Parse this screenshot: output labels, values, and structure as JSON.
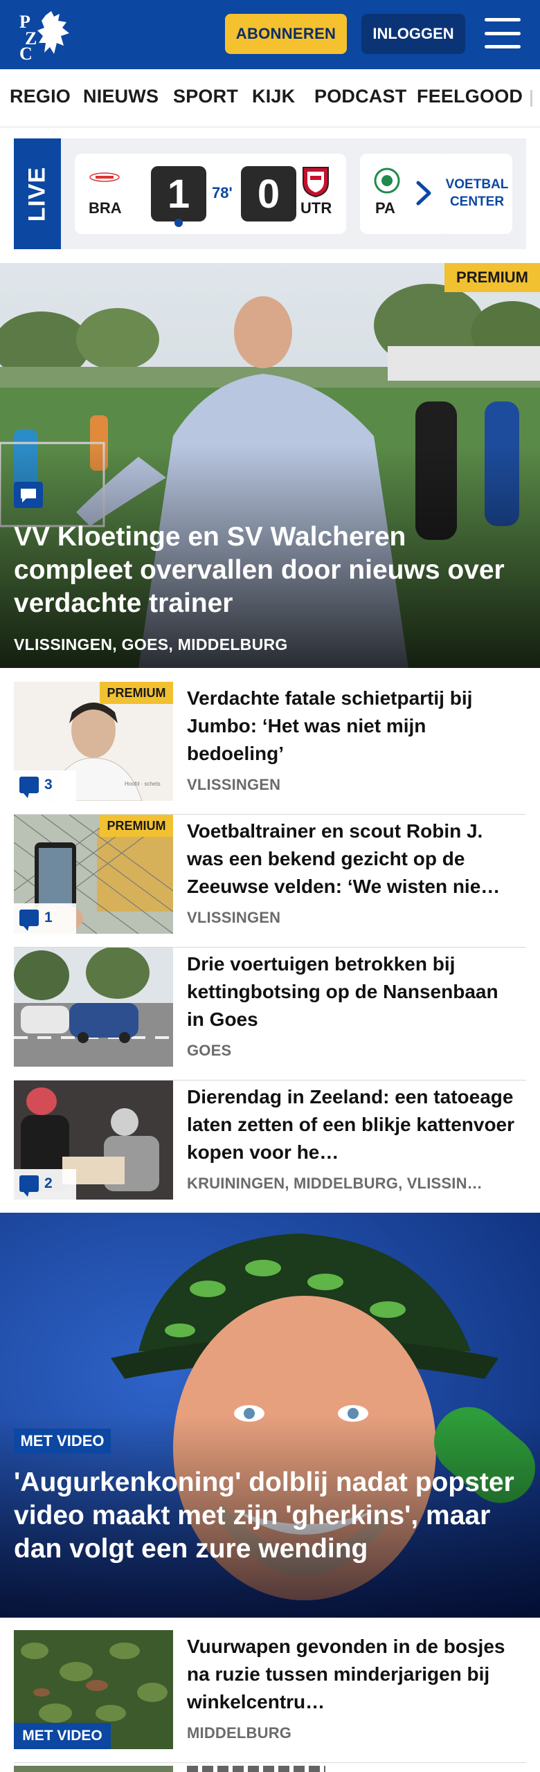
{
  "header": {
    "logo_text": "PZC",
    "subscribe_label": "ABONNEREN",
    "login_label": "INLOGGEN",
    "brand_color": "#0c47a2",
    "accent_color": "#f5c12e"
  },
  "nav": {
    "items": [
      "REGIO",
      "NIEUWS",
      "SPORT",
      "KIJK",
      "PODCAST",
      "FEELGOOD"
    ]
  },
  "live": {
    "label": "LIVE",
    "match": {
      "home": "BRA",
      "away": "UTR",
      "home_score": "1",
      "away_score": "0",
      "minute": "78'"
    },
    "next_match_team": "PA",
    "voetbal_center_label": "VOETBAL CENTER"
  },
  "hero": {
    "badge": "PREMIUM",
    "title": "VV Kloetinge en SV Walcheren compleet overvallen door nieuws over verdachte trainer",
    "location": "VLISSINGEN, GOES, MIDDELBURG"
  },
  "articles": [
    {
      "title": "Verdachte fatale schietpartij bij Jumbo: ‘Het was niet mijn bedoeling’",
      "location": "VLISSINGEN",
      "badge": "PREMIUM",
      "comments": "3"
    },
    {
      "title": "Voetbaltrainer en scout Robin J. was een bekend gezicht op de Zeeuwse velden: ‘We wisten nie…",
      "location": "VLISSINGEN",
      "badge": "PREMIUM",
      "comments": "1"
    },
    {
      "title": "Drie voertuigen betrokken bij kettingbotsing op de Nansenbaan in Goes",
      "location": "GOES"
    },
    {
      "title": "Dierendag in Zeeland: een tatoeage laten zetten of een blikje kattenvoer kopen voor he…",
      "location": "KRUININGEN, MIDDELBURG, VLISSIN…",
      "comments": "2"
    }
  ],
  "video_hero": {
    "badge": "MET VIDEO",
    "title": "'Augurkenkoning' dolblij nadat popster video maakt met zijn 'gherkins', maar dan volgt een zure wending"
  },
  "video_article": {
    "title": "Vuurwapen gevonden in de bosjes na ruzie tussen minderjarigen bij winkelcentru…",
    "location": "MIDDELBURG",
    "badge": "MET VIDEO"
  }
}
